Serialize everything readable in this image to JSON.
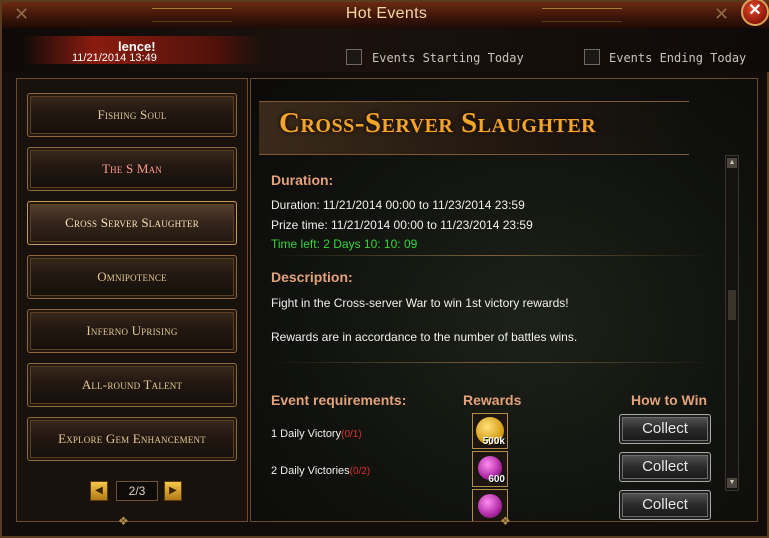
{
  "window": {
    "title": "Hot Events",
    "close_glyph": "✕"
  },
  "ticker": {
    "title": "lence!",
    "time": "11/21/2014 13:49"
  },
  "filters": {
    "starting_today": "Events Starting Today",
    "ending_today": "Events Ending Today"
  },
  "events": [
    {
      "label": "Fishing Soul"
    },
    {
      "label": "The S Man"
    },
    {
      "label": "Cross Server Slaughter"
    },
    {
      "label": "Omnipotence"
    },
    {
      "label": "Inferno Uprising"
    },
    {
      "label": "All-round Talent"
    },
    {
      "label": "Explore Gem Enhancement"
    }
  ],
  "pager": {
    "prev": "◀",
    "next": "▶",
    "text": "2/3"
  },
  "detail": {
    "title": "Cross-Server Slaughter",
    "duration_label": "Duration:",
    "duration": "Duration: 11/21/2014 00:00 to 11/23/2014 23:59",
    "prize_time": "Prize time: 11/21/2014 00:00 to 11/23/2014 23:59",
    "time_left": "Time left: 2 Days  10: 10: 09",
    "description_label": "Description:",
    "description_1": "Fight in the Cross-server War to win 1st victory rewards!",
    "description_2": "Rewards are in accordance to the number of battles wins.",
    "col_requirements": "Event requirements:",
    "col_rewards": "Rewards",
    "col_how_to_win": "How to Win",
    "rows": [
      {
        "requirement": "1 Daily Victory",
        "progress": "(0/1)",
        "reward_qty": "500k",
        "reward_icon": "gold-coin-icon",
        "action": "Collect"
      },
      {
        "requirement": "2 Daily Victories",
        "progress": "(0/2)",
        "reward_qty": "600",
        "reward_icon": "gem-icon",
        "action": "Collect"
      },
      {
        "requirement": "",
        "progress": "",
        "reward_qty": "",
        "reward_icon": "gem-icon",
        "action": "Collect"
      }
    ]
  },
  "colors": {
    "accent_gold": "#f2a52b",
    "label_salmon": "#e3a27a",
    "time_left_green": "#37d437",
    "progress_red": "#d83030"
  }
}
